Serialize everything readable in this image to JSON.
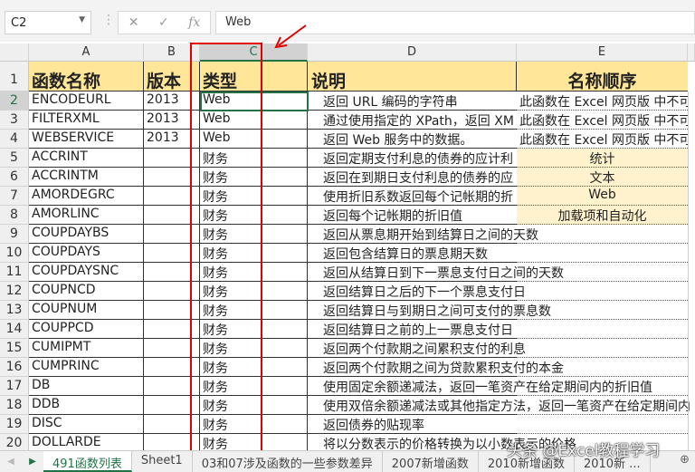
{
  "formula_bar": {
    "name_box": "C2",
    "formula": "Web",
    "fx_label": "fx",
    "cancel": "✕",
    "enter": "✓"
  },
  "columns": [
    "A",
    "B",
    "C",
    "D",
    "E"
  ],
  "header_row": {
    "num": "1",
    "a": "函数名称",
    "b": "版本",
    "c": "类型",
    "d": "说明",
    "e": "名称顺序"
  },
  "rows": [
    {
      "num": "2",
      "a": "ENCODEURL",
      "b": "2013",
      "c": "Web",
      "d": "返回 URL 编码的字符串",
      "e": "此函数在 Excel 网页版 中不可用",
      "efill": false
    },
    {
      "num": "3",
      "a": "FILTERXML",
      "b": "2013",
      "c": "Web",
      "d": "通过使用指定的 XPath，返回 XM",
      "e": "此函数在 Excel 网页版 中不可用",
      "efill": false
    },
    {
      "num": "4",
      "a": "WEBSERVICE",
      "b": "2013",
      "c": "Web",
      "d": "返回 Web 服务中的数据。",
      "e": "此函数在 Excel 网页版 中不可用",
      "efill": false
    },
    {
      "num": "5",
      "a": "ACCRINT",
      "b": "",
      "c": "财务",
      "d": "返回定期支付利息的债券的应计利",
      "e": "统计",
      "efill": true
    },
    {
      "num": "6",
      "a": "ACCRINTM",
      "b": "",
      "c": "财务",
      "d": "返回在到期日支付利息的债券的应",
      "e": "文本",
      "efill": true
    },
    {
      "num": "7",
      "a": "AMORDEGRC",
      "b": "",
      "c": "财务",
      "d": "使用折旧系数返回每个记帐期的折",
      "e": "Web",
      "efill": true
    },
    {
      "num": "8",
      "a": "AMORLINC",
      "b": "",
      "c": "财务",
      "d": "返回每个记帐期的折旧值",
      "e": "加载项和自动化",
      "efill": true
    },
    {
      "num": "9",
      "a": "COUPDAYBS",
      "b": "",
      "c": "财务",
      "d": "返回从票息期开始到结算日之间的天数",
      "e": "",
      "efill": false
    },
    {
      "num": "10",
      "a": "COUPDAYS",
      "b": "",
      "c": "财务",
      "d": "返回包含结算日的票息期天数",
      "e": "",
      "efill": false
    },
    {
      "num": "11",
      "a": "COUPDAYSNC",
      "b": "",
      "c": "财务",
      "d": "返回从结算日到下一票息支付日之间的天数",
      "e": "",
      "efill": false
    },
    {
      "num": "12",
      "a": "COUPNCD",
      "b": "",
      "c": "财务",
      "d": "返回结算日之后的下一个票息支付日",
      "e": "",
      "efill": false
    },
    {
      "num": "13",
      "a": "COUPNUM",
      "b": "",
      "c": "财务",
      "d": "返回结算日与到期日之间可支付的票息数",
      "e": "",
      "efill": false
    },
    {
      "num": "14",
      "a": "COUPPCD",
      "b": "",
      "c": "财务",
      "d": "返回结算日之前的上一票息支付日",
      "e": "",
      "efill": false
    },
    {
      "num": "15",
      "a": "CUMIPMT",
      "b": "",
      "c": "财务",
      "d": "返回两个付款期之间累积支付的利息",
      "e": "",
      "efill": false
    },
    {
      "num": "16",
      "a": "CUMPRINC",
      "b": "",
      "c": "财务",
      "d": "返回两个付款期之间为贷款累积支付的本金",
      "e": "",
      "efill": false
    },
    {
      "num": "17",
      "a": "DB",
      "b": "",
      "c": "财务",
      "d": "使用固定余额递减法，返回一笔资产在给定期间内的折旧值",
      "e": "",
      "efill": false
    },
    {
      "num": "18",
      "a": "DDB",
      "b": "",
      "c": "财务",
      "d": "使用双倍余额递减法或其他指定方法，返回一笔资产在给定期间内",
      "e": "",
      "efill": false
    },
    {
      "num": "19",
      "a": "DISC",
      "b": "",
      "c": "财务",
      "d": "返回债券的贴现率",
      "e": "",
      "efill": false
    },
    {
      "num": "20",
      "a": "DOLLARDE",
      "b": "",
      "c": "财务",
      "d": "将以分数表示的价格转换为以小数表示的价格",
      "e": "",
      "efill": false
    }
  ],
  "sheet_tabs": [
    "491函数列表",
    "Sheet1",
    "03和07涉及函数的一些参数差异",
    "2007新增函数",
    "2010新增函数",
    "2010新 ..."
  ],
  "active_tab": 0,
  "watermark": "头条 @Excel教程学习",
  "colors": {
    "accent": "#217346",
    "header_fill": "#ffe699",
    "e_fill": "#fff2cc",
    "annotation": "#e00000"
  }
}
